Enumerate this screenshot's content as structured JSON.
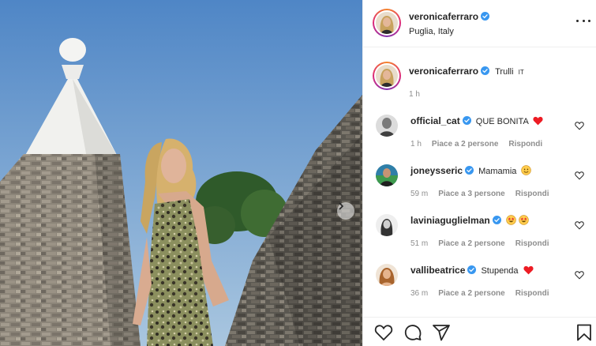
{
  "post": {
    "image_alt": "Woman in leopard-print dress standing between trulli stone roofs against a blue sky",
    "next_icon": "chevron-right-icon"
  },
  "header": {
    "username": "veronicaferraro",
    "verified": true,
    "location": "Puglia, Italy",
    "more_icon": "more-horizontal-icon"
  },
  "caption": {
    "username": "veronicaferraro",
    "verified": true,
    "text": "Trulli",
    "flag": "IT",
    "time": "1 h"
  },
  "comments": [
    {
      "username": "official_cat",
      "verified": true,
      "text": "QUE BONITA",
      "emoji": "red-heart",
      "time": "1 h",
      "likes": "Piace a 2 persone",
      "reply": "Rispondi"
    },
    {
      "username": "joneysseric",
      "verified": true,
      "text": "Mamamia",
      "emoji": "smiling-face",
      "time": "59 m",
      "likes": "Piace a 3 persone",
      "reply": "Rispondi"
    },
    {
      "username": "laviniaguglielman",
      "verified": true,
      "text": "",
      "emoji": "star-struck x2",
      "time": "51 m",
      "likes": "Piace a 2 persone",
      "reply": "Rispondi"
    },
    {
      "username": "vallibeatrice",
      "verified": true,
      "text": "Stupenda",
      "emoji": "red-heart",
      "time": "36 m",
      "likes": "Piace a 2 persone",
      "reply": "Rispondi"
    }
  ],
  "actions": {
    "like_icon": "heart-icon",
    "comment_icon": "comment-icon",
    "share_icon": "send-icon",
    "save_icon": "bookmark-icon"
  },
  "colors": {
    "verified": "#3897f0",
    "heart": "#ed4956",
    "text": "#262626",
    "meta": "#8e8e8e",
    "sky": "#6e9fcf"
  }
}
